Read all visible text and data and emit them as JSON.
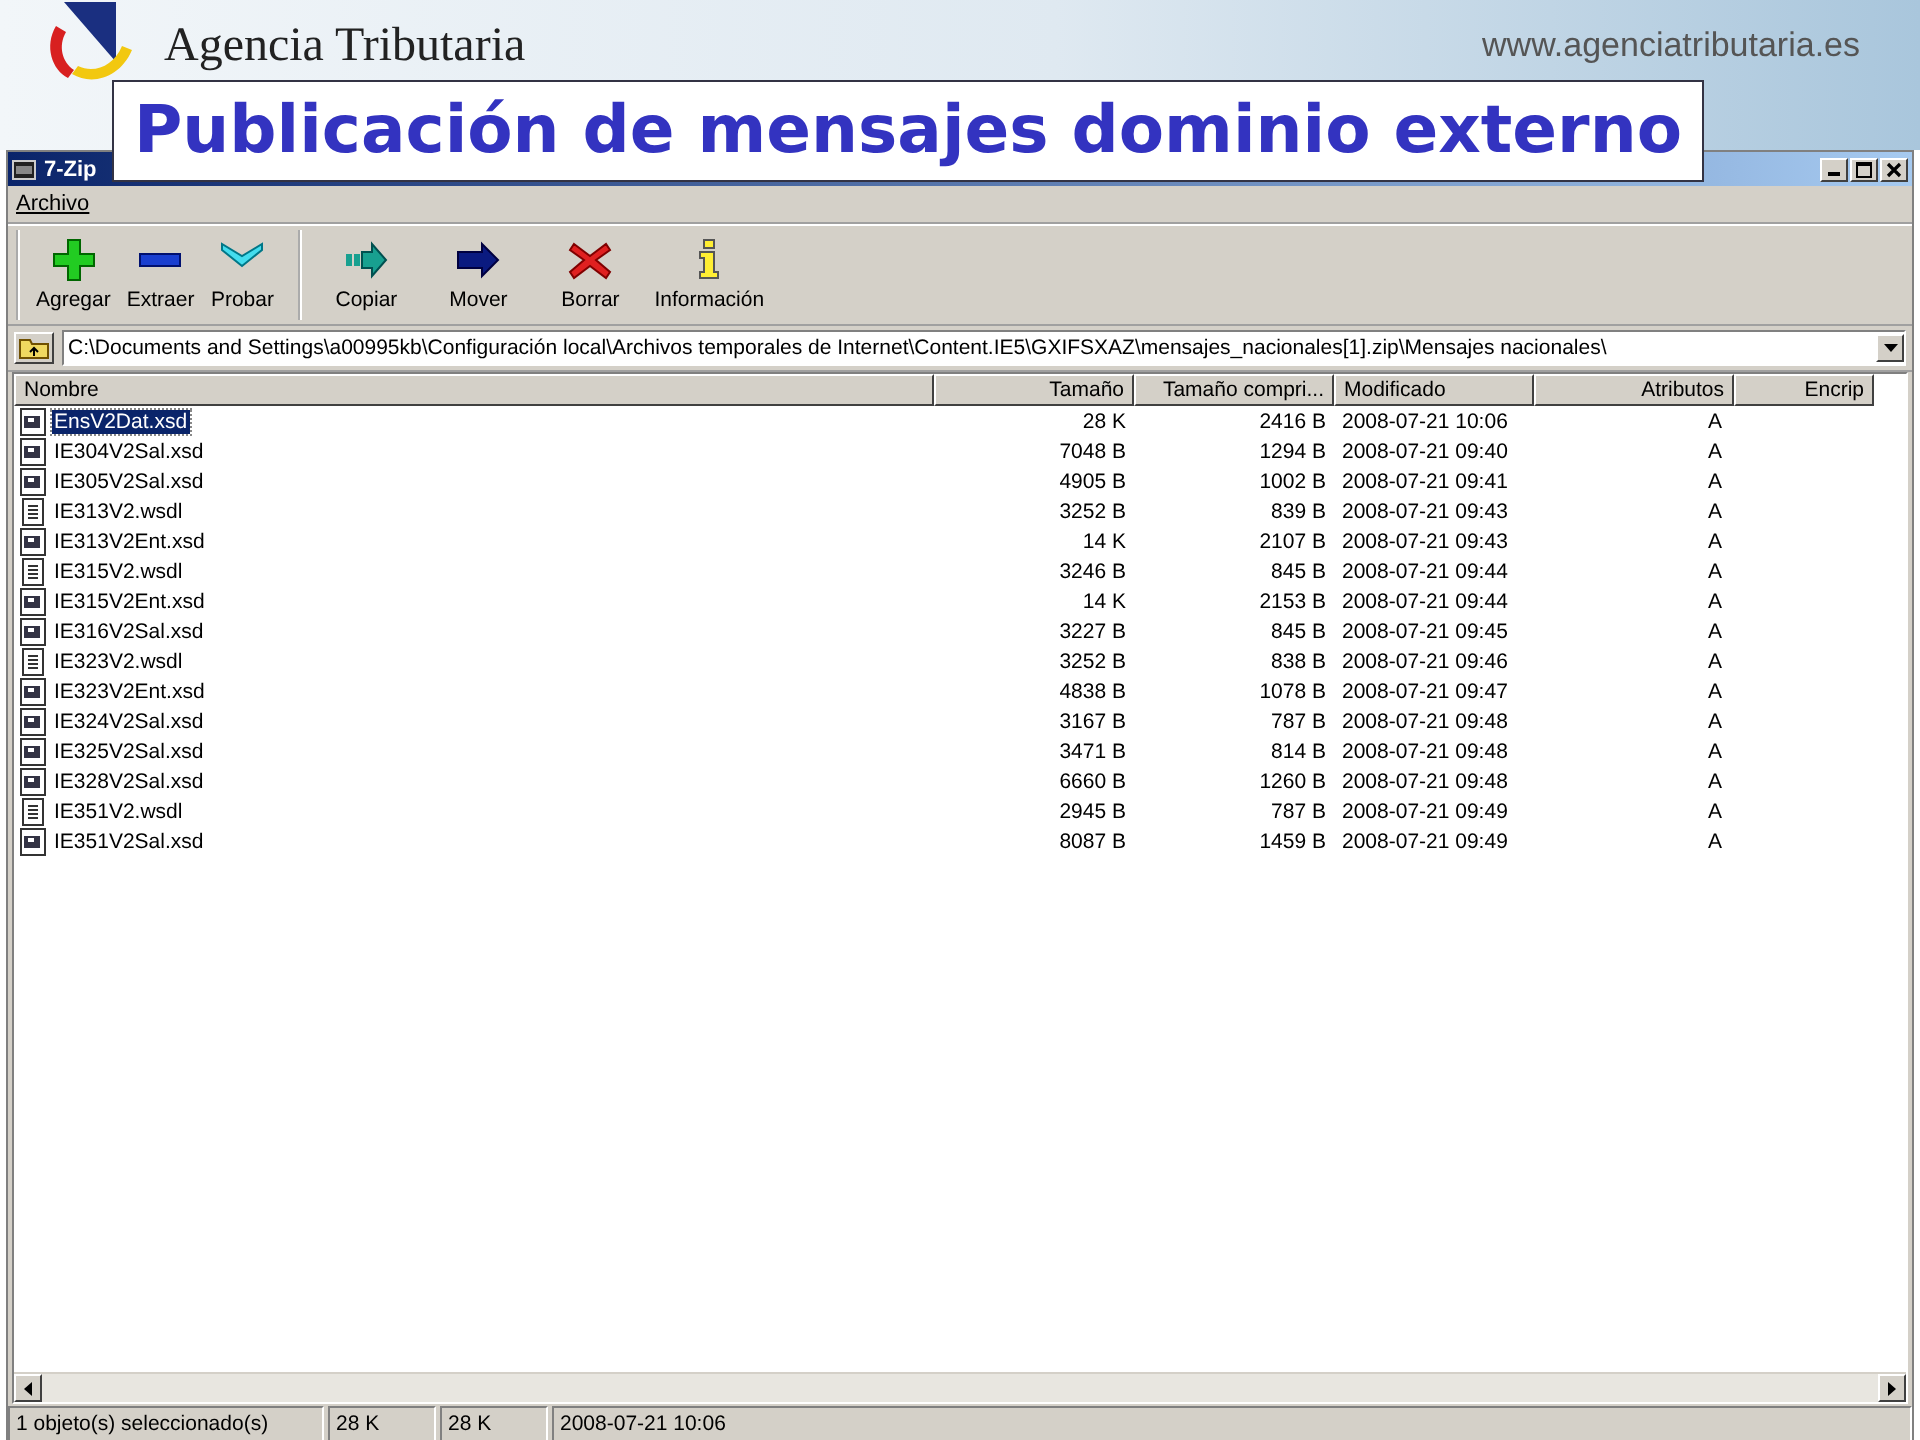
{
  "slide": {
    "brand": "Agencia Tributaria",
    "url": "www.agenciatributaria.es",
    "title": "Publicación de mensajes dominio externo"
  },
  "window": {
    "title": "7-Zip"
  },
  "menu": [
    "Archivo"
  ],
  "toolbar": [
    {
      "label": "Agregar",
      "kind": "add"
    },
    {
      "label": "Extraer",
      "kind": "extract"
    },
    {
      "label": "Probar",
      "kind": "test"
    },
    {
      "label": "Copiar",
      "kind": "copy"
    },
    {
      "label": "Mover",
      "kind": "move"
    },
    {
      "label": "Borrar",
      "kind": "delete"
    },
    {
      "label": "Información",
      "kind": "info"
    }
  ],
  "address": {
    "value": "C:\\Documents and Settings\\a00995kb\\Configuración local\\Archivos temporales de Internet\\Content.IE5\\GXIFSXAZ\\mensajes_nacionales[1].zip\\Mensajes nacionales\\"
  },
  "table": {
    "columns": [
      "Nombre",
      "Tamaño",
      "Tamaño compri...",
      "Modificado",
      "Atributos",
      "Encrip"
    ],
    "rows": [
      {
        "kind": "schema",
        "selected": true,
        "cells": [
          "EnsV2Dat.xsd",
          "28 K",
          "2416 B",
          "2008-07-21 10:06",
          "A"
        ]
      },
      {
        "kind": "schema",
        "selected": false,
        "cells": [
          "IE304V2Sal.xsd",
          "7048 B",
          "1294 B",
          "2008-07-21 09:40",
          "A"
        ]
      },
      {
        "kind": "schema",
        "selected": false,
        "cells": [
          "IE305V2Sal.xsd",
          "4905 B",
          "1002 B",
          "2008-07-21 09:41",
          "A"
        ]
      },
      {
        "kind": "text",
        "selected": false,
        "cells": [
          "IE313V2.wsdl",
          "3252 B",
          "839 B",
          "2008-07-21 09:43",
          "A"
        ]
      },
      {
        "kind": "schema",
        "selected": false,
        "cells": [
          "IE313V2Ent.xsd",
          "14 K",
          "2107 B",
          "2008-07-21 09:43",
          "A"
        ]
      },
      {
        "kind": "text",
        "selected": false,
        "cells": [
          "IE315V2.wsdl",
          "3246 B",
          "845 B",
          "2008-07-21 09:44",
          "A"
        ]
      },
      {
        "kind": "schema",
        "selected": false,
        "cells": [
          "IE315V2Ent.xsd",
          "14 K",
          "2153 B",
          "2008-07-21 09:44",
          "A"
        ]
      },
      {
        "kind": "schema",
        "selected": false,
        "cells": [
          "IE316V2Sal.xsd",
          "3227 B",
          "845 B",
          "2008-07-21 09:45",
          "A"
        ]
      },
      {
        "kind": "text",
        "selected": false,
        "cells": [
          "IE323V2.wsdl",
          "3252 B",
          "838 B",
          "2008-07-21 09:46",
          "A"
        ]
      },
      {
        "kind": "schema",
        "selected": false,
        "cells": [
          "IE323V2Ent.xsd",
          "4838 B",
          "1078 B",
          "2008-07-21 09:47",
          "A"
        ]
      },
      {
        "kind": "schema",
        "selected": false,
        "cells": [
          "IE324V2Sal.xsd",
          "3167 B",
          "787 B",
          "2008-07-21 09:48",
          "A"
        ]
      },
      {
        "kind": "schema",
        "selected": false,
        "cells": [
          "IE325V2Sal.xsd",
          "3471 B",
          "814 B",
          "2008-07-21 09:48",
          "A"
        ]
      },
      {
        "kind": "schema",
        "selected": false,
        "cells": [
          "IE328V2Sal.xsd",
          "6660 B",
          "1260 B",
          "2008-07-21 09:48",
          "A"
        ]
      },
      {
        "kind": "text",
        "selected": false,
        "cells": [
          "IE351V2.wsdl",
          "2945 B",
          "787 B",
          "2008-07-21 09:49",
          "A"
        ]
      },
      {
        "kind": "schema",
        "selected": false,
        "cells": [
          "IE351V2Sal.xsd",
          "8087 B",
          "1459 B",
          "2008-07-21 09:49",
          "A"
        ]
      }
    ]
  },
  "status_bar": [
    "1 objeto(s) seleccionado(s)",
    "28 K",
    "28 K",
    "2008-07-21 10:06"
  ]
}
